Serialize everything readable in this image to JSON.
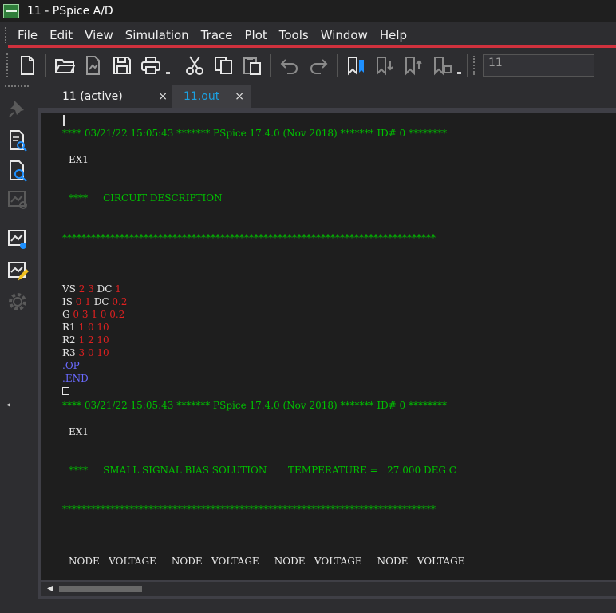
{
  "window": {
    "title": "11 - PSpice A/D"
  },
  "menu": [
    "File",
    "Edit",
    "View",
    "Simulation",
    "Trace",
    "Plot",
    "Tools",
    "Window",
    "Help"
  ],
  "toolbar": {
    "icons": [
      "new-file-icon",
      "open-folder-icon",
      "new-profile-icon",
      "save-icon",
      "print-icon",
      "cut-icon",
      "copy-icon",
      "paste-icon",
      "undo-icon",
      "redo-icon",
      "bookmark-toggle-icon",
      "bookmark-next-icon",
      "bookmark-prev-icon",
      "bookmark-clear-icon"
    ],
    "combo_value": "11"
  },
  "left_toolbar": {
    "icons": [
      "pin-icon",
      "view-netlist-icon",
      "view-output-icon",
      "view-simulation-icon",
      "simulation-settings-icon",
      "edit-profile-icon",
      "gear-icon"
    ]
  },
  "tabs": [
    {
      "label": "11 (active)",
      "close": "×",
      "active": false
    },
    {
      "label": "11.out",
      "close": "×",
      "active": true
    }
  ],
  "output": {
    "header1": "**** 03/21/22 15:05:43 ******* PSpice 17.4.0 (Nov 2018) ******* ID# 0 ********",
    "ex1_a": "EX1",
    "circuit_title": "****     CIRCUIT DESCRIPTION",
    "stars": "******************************************************************************",
    "netlist": [
      {
        "name": "VS",
        "nodes": "2 3",
        "kw": "DC",
        "val": "1"
      },
      {
        "name": "IS",
        "nodes": "0 1",
        "kw": "DC",
        "val": "0.2"
      },
      {
        "name": "G",
        "nodes": "0 3 1 0 0.2",
        "kw": "",
        "val": ""
      },
      {
        "name": "R1",
        "nodes": "1 0 10",
        "kw": "",
        "val": ""
      },
      {
        "name": "R2",
        "nodes": "1 2 10",
        "kw": "",
        "val": ""
      },
      {
        "name": "R3",
        "nodes": "3 0 10",
        "kw": "",
        "val": ""
      }
    ],
    "op": ".OP",
    "end": ".END",
    "header2": "**** 03/21/22 15:05:43 ******* PSpice 17.4.0 (Nov 2018) ******* ID# 0 ********",
    "ex1_b": "EX1",
    "bias_title": "****     SMALL SIGNAL BIAS SOLUTION       TEMPERATURE =   27.000 DEG C",
    "stars2": "******************************************************************************",
    "node_header": "NODE   VOLTAGE     NODE   VOLTAGE     NODE   VOLTAGE     NODE   VOLTAGE"
  }
}
